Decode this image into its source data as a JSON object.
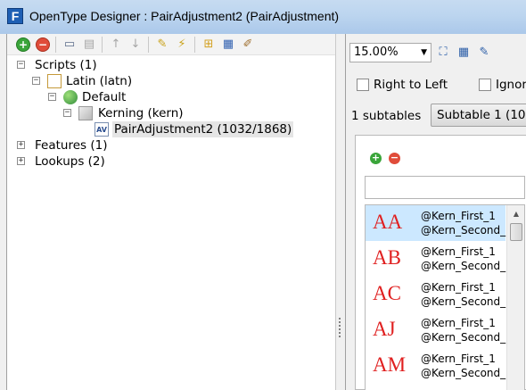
{
  "window": {
    "title": "OpenType Designer : PairAdjustment2 (PairAdjustment)"
  },
  "toolbar": {
    "add": "+",
    "remove": "−"
  },
  "tree": {
    "scripts": "Scripts (1)",
    "latin": "Latin (latn)",
    "default": "Default",
    "kerning": "Kerning (kern)",
    "pair_adjustment": "PairAdjustment2 (1032/1868)",
    "features": "Features (1)",
    "lookups": "Lookups (2)"
  },
  "right": {
    "zoom_value": "15.00%",
    "right_to_left": "Right to Left",
    "ignore": "Ignor",
    "subtables_count": "1 subtables",
    "subtable_button": "Subtable 1 (103",
    "filter_value": ""
  },
  "pairs": [
    {
      "glyphs": "AA",
      "first": "@Kern_First_1",
      "second": "@Kern_Second_"
    },
    {
      "glyphs": "AB",
      "first": "@Kern_First_1",
      "second": "@Kern_Second_"
    },
    {
      "glyphs": "AC",
      "first": "@Kern_First_1",
      "second": "@Kern_Second_"
    },
    {
      "glyphs": "AJ",
      "first": "@Kern_First_1",
      "second": "@Kern_Second_"
    },
    {
      "glyphs": "AM",
      "first": "@Kern_First_1",
      "second": "@Kern_Second_"
    }
  ],
  "colors": {
    "accent": "#1e5fb4",
    "selection": "#cce8ff",
    "glyph": "#e02020"
  }
}
